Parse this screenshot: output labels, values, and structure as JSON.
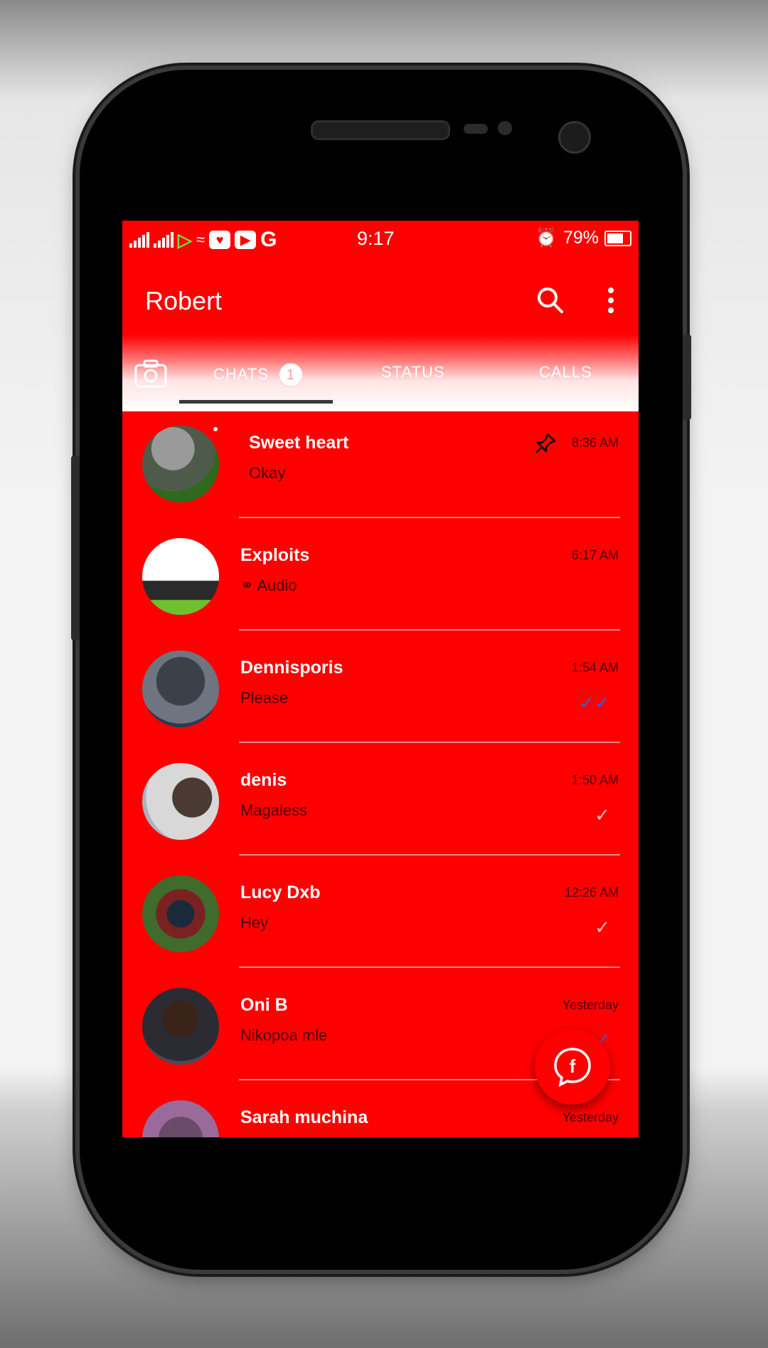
{
  "statusbar": {
    "time": "9:17",
    "battery": "79%",
    "icons": [
      "signal-icon",
      "signal-icon",
      "data-saver-icon",
      "wifi-icon",
      "heart-app-icon",
      "youtube-icon",
      "google-icon",
      "alarm-icon",
      "battery-icon"
    ]
  },
  "appbar": {
    "title": "Robert",
    "icons": [
      "search-icon",
      "more-vert-icon"
    ]
  },
  "tabs": {
    "camera_icon": "camera-icon",
    "items": [
      {
        "label": "CHATS",
        "badge": "1",
        "selected": true
      },
      {
        "label": "STATUS"
      },
      {
        "label": "CALLS"
      }
    ]
  },
  "chats": [
    {
      "name": "Sweet heart",
      "message": "Okay",
      "time": "8:36 AM",
      "pinned": true
    },
    {
      "name": "Exploits",
      "message": "Audio",
      "message_icon": "headphones-icon",
      "time": "6:17 AM"
    },
    {
      "name": "Dennisporis",
      "message": "Please",
      "time": "1:54 AM",
      "tick": "✓✓",
      "tick_color": "#3a5bd9"
    },
    {
      "name": "denis",
      "message": "Magaless",
      "time": "1:50 AM",
      "tick": "✓",
      "tick_color": "#ffb3b3"
    },
    {
      "name": "Lucy Dxb",
      "message": "Hey",
      "time": "12:26 AM",
      "tick": "✓",
      "tick_color": "#ffb3b3"
    },
    {
      "name": "Oni B",
      "message": "Nikopoa mle",
      "time": "Yesterday",
      "tick": "✓",
      "tick_color": "#3a5bd9"
    },
    {
      "name": "Sarah muchina",
      "message": "",
      "time": "Yesterday"
    }
  ],
  "fab": {
    "icon": "facebook-chat-icon"
  },
  "colors": {
    "accent": "#ff0000",
    "phone_body": "#000000",
    "divider": "#ff8a8a"
  }
}
